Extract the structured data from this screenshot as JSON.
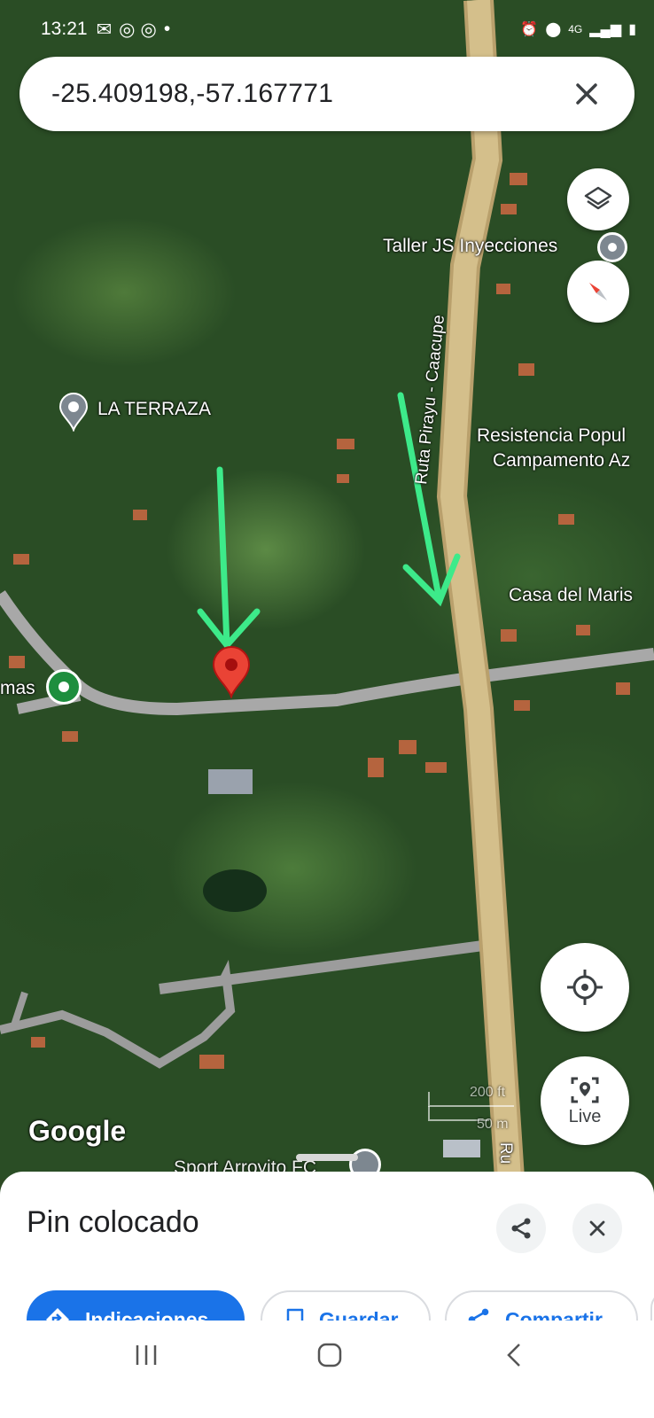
{
  "status_bar": {
    "time": "13:21",
    "network": "4G"
  },
  "search": {
    "query": "-25.409198,-57.167771"
  },
  "map": {
    "places": {
      "taller": "Taller JS Inyecciones",
      "la_terraza": "LA TERRAZA",
      "resistencia_1": "Resistencia Popul",
      "resistencia_2": "Campamento Az",
      "casa_del_maris": "Casa del Maris",
      "mas": "mas",
      "sport": "Sport Arroyito FC"
    },
    "road_label": "Ruta Pirayu - Caacupe",
    "road_label_bottom": "Ru",
    "google": "Google",
    "scale": {
      "feet": "200 ft",
      "meters": "50 m"
    },
    "live_label": "Live",
    "colors": {
      "pin": "#ea4335",
      "arrow": "#3dea8a",
      "road_main": "#c9b27a",
      "road_minor": "#9a9a9a"
    }
  },
  "sheet": {
    "title": "Pin colocado",
    "actions": {
      "directions": "Indicaciones",
      "save": "Guardar",
      "share": "Compartir"
    }
  }
}
